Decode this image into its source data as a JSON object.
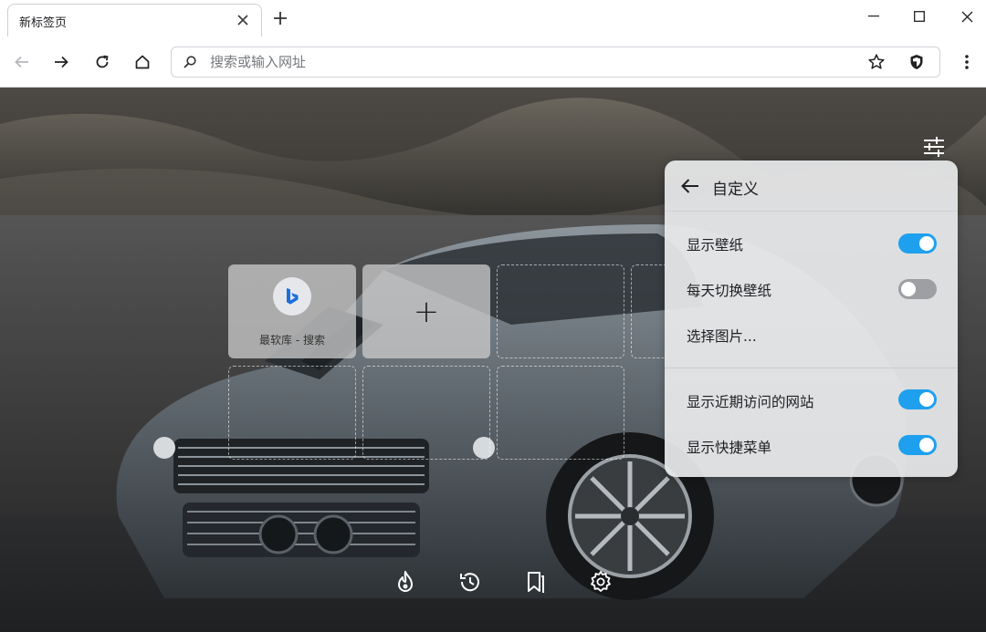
{
  "tab": {
    "title": "新标签页",
    "close_icon": "close-icon"
  },
  "toolbar": {
    "search_placeholder": "搜索或输入网址"
  },
  "shortcuts": [
    {
      "label": "最软库 - 搜索",
      "icon": "bing-icon"
    }
  ],
  "add_shortcut": {
    "symbol": "+"
  },
  "panel": {
    "title": "自定义",
    "options": [
      {
        "label": "显示壁纸",
        "enabled": true
      },
      {
        "label": "每天切换壁纸",
        "enabled": false
      },
      {
        "label": "选择图片..."
      },
      {
        "label": "显示近期访问的网站",
        "enabled": true
      },
      {
        "label": "显示快捷菜单",
        "enabled": true
      }
    ]
  },
  "colors": {
    "accent": "#1ea0ee",
    "toggle_off": "#9d9fa2"
  },
  "bottom_bar_icons": [
    "flame-icon",
    "history-icon",
    "bookmarks-icon",
    "settings-icon"
  ]
}
